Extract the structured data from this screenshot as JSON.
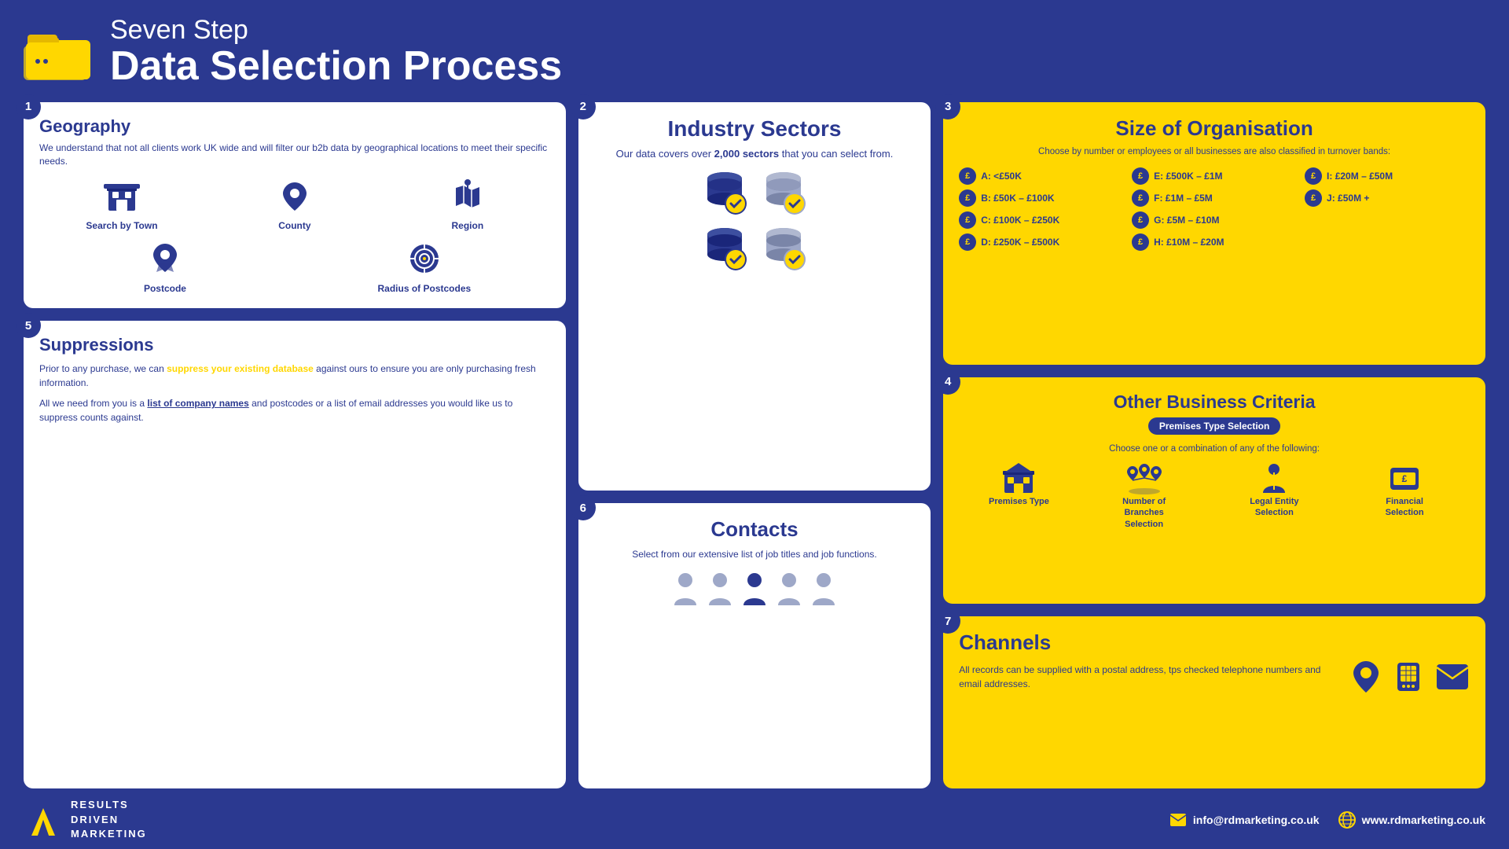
{
  "header": {
    "subtitle": "Seven Step",
    "title": "Data Selection Process"
  },
  "step1": {
    "number": "1",
    "title": "Geography",
    "description": "We understand that not all clients work UK wide and will filter our b2b data by geographical locations to meet their specific needs.",
    "icons": [
      {
        "label": "Search by Town",
        "icon": "building"
      },
      {
        "label": "County",
        "icon": "map-pin"
      },
      {
        "label": "Region",
        "icon": "map"
      },
      {
        "label": "Postcode",
        "icon": "postcode"
      },
      {
        "label": "Radius of Postcodes",
        "icon": "radius"
      }
    ]
  },
  "step2": {
    "number": "2",
    "title": "Industry Sectors",
    "description": "Our data covers over",
    "highlight": "2,000 sectors",
    "description2": "that you can select from."
  },
  "step3": {
    "number": "3",
    "title": "Size of Organisation",
    "subtitle": "Choose by number or employees or all businesses are also classified in turnover bands:",
    "bands": [
      "A: <£50K",
      "E: £500K – £1M",
      "I: £20M – £50M",
      "B: £50K – £100K",
      "F: £1M – £5M",
      "J: £50M +",
      "C: £100K – £250K",
      "G: £5M – £10M",
      "",
      "D: £250K – £500K",
      "H: £10M – £20M",
      ""
    ]
  },
  "step4": {
    "number": "4",
    "title": "Other Business Criteria",
    "badge": "Premises Type Selection",
    "subtitle": "Choose one or a combination of any of the following:",
    "criteria": [
      {
        "label": "Premises Type"
      },
      {
        "label": "Number of Branches Selection"
      },
      {
        "label": "Legal Entity Selection"
      },
      {
        "label": "Financial Selection"
      }
    ]
  },
  "step5": {
    "number": "5",
    "title": "Suppressions",
    "para1": "Prior to any purchase, we can",
    "highlight1": "suppress your existing database",
    "para1b": "against ours to ensure you are only purchasing fresh information.",
    "para2_pre": "All we need from you is a",
    "highlight2": "list of company names",
    "para2b": "and postcodes or a list of email addresses you would like us to suppress counts against."
  },
  "step6": {
    "number": "6",
    "title": "Contacts",
    "description": "Select from our extensive list of job titles and job functions."
  },
  "step7": {
    "number": "7",
    "title": "Channels",
    "description": "All records can be supplied with a postal address, tps checked telephone numbers and email addresses."
  },
  "footer": {
    "logo_line1": "RESULTS",
    "logo_line2": "DRIVEN",
    "logo_line3": "MARKETING",
    "email": "info@rdmarketing.co.uk",
    "website": "www.rdmarketing.co.uk"
  }
}
